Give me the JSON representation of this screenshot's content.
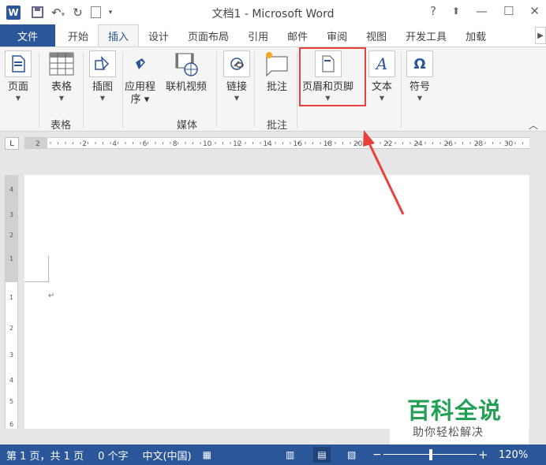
{
  "window": {
    "title": "文档1 - Microsoft Word",
    "app_icon": "W",
    "help": "?",
    "restore": "⬆",
    "minimize": "—",
    "maximize": "☐",
    "close": "✕"
  },
  "tabs": [
    {
      "label": "文件"
    },
    {
      "label": "开始"
    },
    {
      "label": "插入"
    },
    {
      "label": "设计"
    },
    {
      "label": "页面布局"
    },
    {
      "label": "引用"
    },
    {
      "label": "邮件"
    },
    {
      "label": "审阅"
    },
    {
      "label": "视图"
    },
    {
      "label": "开发工具"
    },
    {
      "label": "加载"
    }
  ],
  "ribbon": {
    "page": "页面",
    "table": "表格",
    "illustrations": "插图",
    "apps_line1": "应用程",
    "apps_line2": "序",
    "online_video": "联机视频",
    "link": "链接",
    "comment": "批注",
    "header_footer": "页眉和页脚",
    "text": "文本",
    "symbols": "符号",
    "groups": {
      "table": "表格",
      "media": "媒体",
      "comments": "批注"
    }
  },
  "ruler": {
    "corner": "L",
    "h_ticks": [
      "2",
      "2",
      "4",
      "6",
      "8",
      "10",
      "12",
      "14",
      "16",
      "18",
      "20",
      "22",
      "24",
      "26",
      "28",
      "30"
    ],
    "v_ticks": [
      "4",
      "3",
      "2",
      "1",
      "1",
      "2",
      "3",
      "4",
      "5",
      "6"
    ]
  },
  "document": {
    "paragraph_mark": "↵"
  },
  "watermark": {
    "title": "百科全说",
    "subtitle": "助你轻松解决"
  },
  "status": {
    "page": "第 1 页，共 1 页",
    "words": "0 个字",
    "language": "中文(中国)",
    "zoom": "120%"
  },
  "colors": {
    "accent": "#2b579a",
    "highlight": "#e8403a",
    "watermark": "#22a053"
  }
}
